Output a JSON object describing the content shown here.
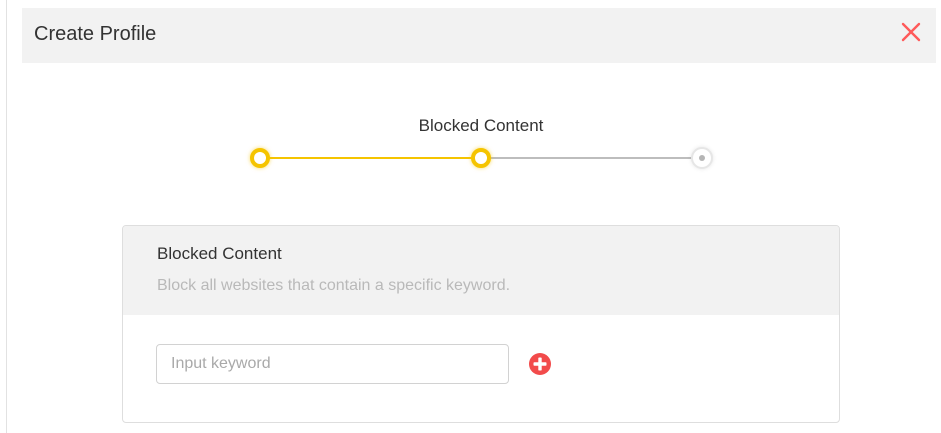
{
  "dialog": {
    "title": "Create Profile",
    "close_icon": "close-icon"
  },
  "stepper": {
    "current_label": "Blocked Content",
    "steps_total": 3,
    "current_step": 2
  },
  "blocked_content": {
    "title": "Blocked Content",
    "description": "Block all websites that contain a specific keyword.",
    "keyword_input": {
      "value": "",
      "placeholder": "Input keyword"
    },
    "add_icon": "plus-circle-icon"
  },
  "colors": {
    "accent": "#f5c400",
    "close": "#ff5a5a",
    "add": "#f24b4b",
    "inactive_line": "#bdbdbd"
  }
}
